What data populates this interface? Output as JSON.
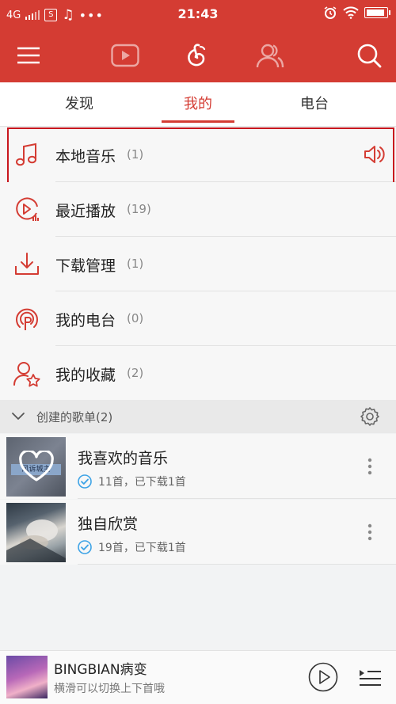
{
  "status_bar": {
    "network": "4G",
    "time": "21:43",
    "icons": [
      "signal-icon",
      "sim-icon",
      "music-note-icon",
      "more-dots-icon",
      "alarm-icon",
      "wifi-icon",
      "battery-icon"
    ]
  },
  "top_bar": {
    "icons": [
      "menu-icon",
      "video-icon",
      "netease-music-icon",
      "friends-icon",
      "search-icon"
    ]
  },
  "tabs": [
    {
      "label": "发现",
      "active": false
    },
    {
      "label": "我的",
      "active": true
    },
    {
      "label": "电台",
      "active": false
    }
  ],
  "menu": [
    {
      "label": "本地音乐",
      "count": "(1)",
      "icon": "music-note-icon",
      "highlighted": true
    },
    {
      "label": "最近播放",
      "count": "(19)",
      "icon": "recent-play-icon"
    },
    {
      "label": "下载管理",
      "count": "(1)",
      "icon": "download-icon"
    },
    {
      "label": "我的电台",
      "count": "(0)",
      "icon": "radio-icon"
    },
    {
      "label": "我的收藏",
      "count": "(2)",
      "icon": "collection-icon"
    }
  ],
  "section": {
    "label": "创建的歌单(2)"
  },
  "playlists": [
    {
      "title": "我喜欢的音乐",
      "meta": "11首，已下载1首",
      "cover_text": "风诉城主"
    },
    {
      "title": "独自欣赏",
      "meta": "19首，已下载1首"
    }
  ],
  "player": {
    "title": "BINGBIAN病变",
    "subtitle": "横滑可以切换上下首哦"
  },
  "colors": {
    "brand_red": "#d43c33",
    "highlight_border": "#c8161d",
    "check_blue": "#3da3e6"
  }
}
